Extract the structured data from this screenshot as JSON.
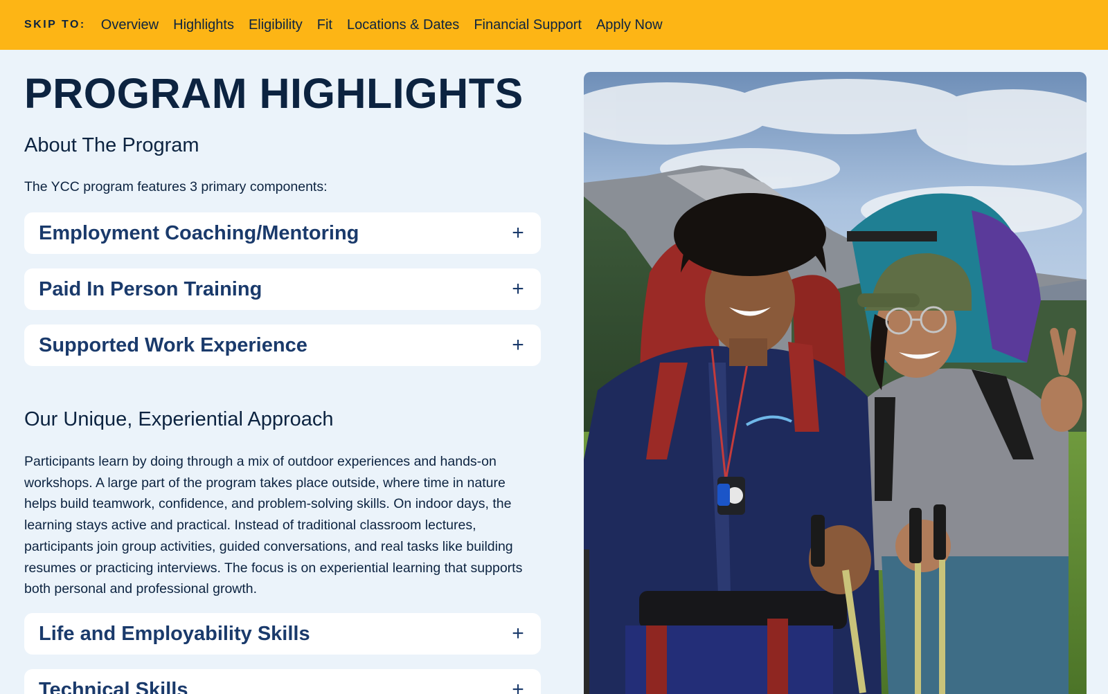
{
  "skipbar": {
    "label": "SKIP TO:",
    "links": [
      "Overview",
      "Highlights",
      "Eligibility",
      "Fit",
      "Locations & Dates",
      "Financial Support",
      "Apply Now"
    ]
  },
  "page_title": "PROGRAM HIGHLIGHTS",
  "about": {
    "heading": "About The Program",
    "intro": "The YCC program features 3 primary components:",
    "accordions": [
      {
        "title": "Employment Coaching/Mentoring",
        "icon": "plus-icon"
      },
      {
        "title": "Paid In Person Training",
        "icon": "plus-icon"
      },
      {
        "title": "Supported Work Experience",
        "icon": "plus-icon"
      }
    ]
  },
  "approach": {
    "heading": "Our Unique, Experiential Approach",
    "body": "Participants learn by doing through a mix of outdoor experiences and hands-on workshops. A large part of the program takes place outside, where time in nature helps build teamwork, confidence, and problem-solving skills. On indoor days, the learning stays active and practical. Instead of  traditional classroom lectures, participants join group activities, guided conversations, and real tasks like building resumes or practicing interviews. The focus is on experiential learning that supports both personal and professional growth.",
    "accordions": [
      {
        "title": "Life and Employability Skills",
        "icon": "plus-icon"
      },
      {
        "title": "Technical Skills",
        "icon": "plus-icon"
      }
    ]
  },
  "photo": {
    "icon": "hikers-photo"
  },
  "colors": {
    "skipbar_bg": "#fdb515",
    "page_bg": "#ebf3fa",
    "navy": "#0c2340",
    "accordion_title": "#1a3a6b",
    "card_bg": "#ffffff"
  }
}
